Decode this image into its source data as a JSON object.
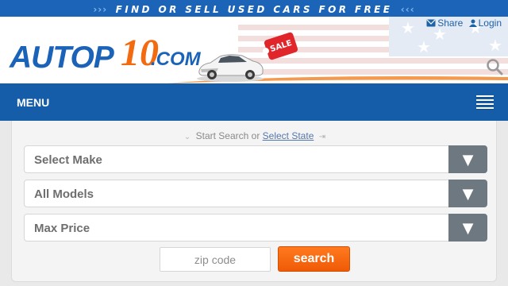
{
  "banner": {
    "left_arrows": "›››",
    "tagline": "FIND OR SELL USED CARS FOR FREE",
    "right_arrows": "‹‹‹"
  },
  "header": {
    "logo_auto": "AUTOP",
    "logo_ten": "10",
    "logo_com": ".COM",
    "sale_tag": "SALE",
    "links": {
      "share": "Share",
      "login": "Login"
    },
    "search_icon": "magnifier-icon"
  },
  "nav": {
    "menu_label": "MENU",
    "menu_icon": "hamburger-icon"
  },
  "search_panel": {
    "hint_prefix": "Start Search or",
    "hint_link": "Select State",
    "selects": [
      {
        "label": "Select Make"
      },
      {
        "label": "All Models"
      },
      {
        "label": "Max Price"
      }
    ],
    "arrow_glyph": "▼",
    "zip_placeholder": "zip code",
    "search_button": "search"
  },
  "colors": {
    "brand_blue": "#155da8",
    "banner_blue": "#1b64b7",
    "accent_orange": "#f26b11",
    "select_arrow_bg": "#6e7880"
  }
}
